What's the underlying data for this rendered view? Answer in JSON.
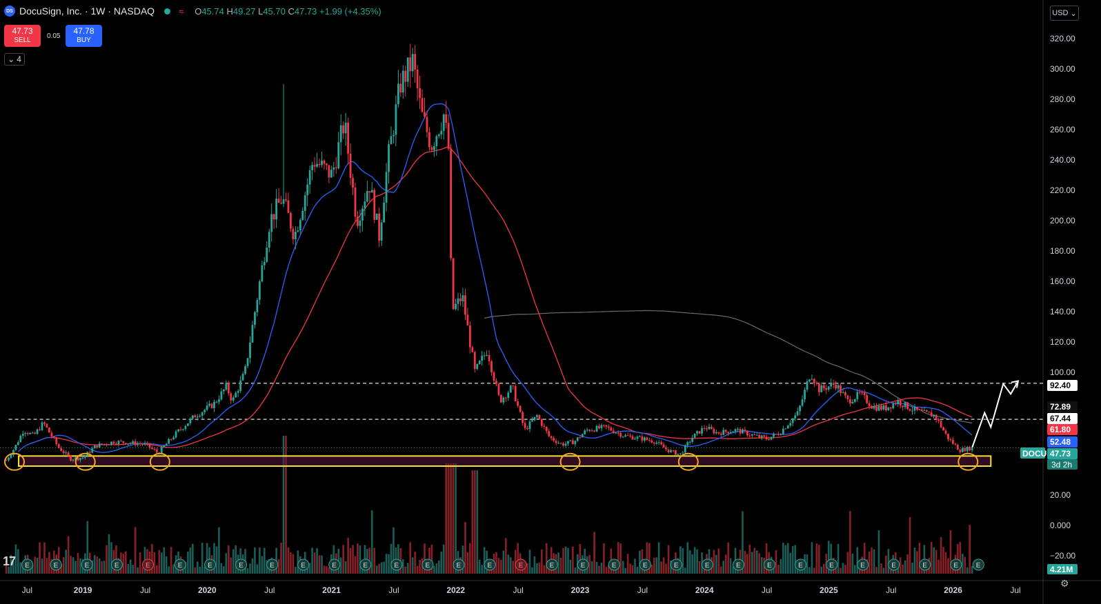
{
  "header": {
    "logo_text": "DS",
    "title": "DocuSign, Inc. · 1W · NASDAQ",
    "wave_icon": "≈",
    "ohlc": {
      "o_label": "O",
      "o": "45.74",
      "h_label": "H",
      "h": "49.27",
      "l_label": "L",
      "l": "45.70",
      "c_label": "C",
      "c": "47.73",
      "change": "+1.99 (+4.35%)"
    }
  },
  "trade": {
    "sell_price": "47.73",
    "sell_label": "SELL",
    "spread": "0.05",
    "buy_price": "47.78",
    "buy_label": "BUY"
  },
  "indicators_count": "4",
  "currency": "USD",
  "tv_logo": "17",
  "colors": {
    "up": "#26a69a",
    "down": "#f23645",
    "ma_fast": "#2962ff",
    "ma_slow": "#f23645",
    "ma_long": "#6b6b6b",
    "zone": "#f5e03a",
    "circle": "#f5a623",
    "bg": "#000000"
  },
  "chart_data": {
    "type": "candlestick",
    "symbol": "DOCU",
    "timeframe": "1W",
    "y_axis_ticks": [
      320,
      300,
      280,
      260,
      240,
      220,
      200,
      180,
      160,
      140,
      120,
      100,
      20,
      0,
      -20
    ],
    "y_axis_tick_labels": [
      "320.00",
      "300.00",
      "280.00",
      "260.00",
      "240.00",
      "220.00",
      "200.00",
      "180.00",
      "160.00",
      "140.00",
      "120.00",
      "100.00",
      "20.00",
      "0.000",
      "−20.00"
    ],
    "ylim": [
      30,
      330
    ],
    "x_axis_labels": [
      {
        "t": 2018.55,
        "label": "Jul"
      },
      {
        "t": 2019.0,
        "label": "2019"
      },
      {
        "t": 2019.5,
        "label": "Jul"
      },
      {
        "t": 2020.0,
        "label": "2020"
      },
      {
        "t": 2020.5,
        "label": "Jul"
      },
      {
        "t": 2021.0,
        "label": "2021"
      },
      {
        "t": 2021.5,
        "label": "Jul"
      },
      {
        "t": 2022.0,
        "label": "2022"
      },
      {
        "t": 2022.5,
        "label": "Jul"
      },
      {
        "t": 2023.0,
        "label": "2023"
      },
      {
        "t": 2023.5,
        "label": "Jul"
      },
      {
        "t": 2024.0,
        "label": "2024"
      },
      {
        "t": 2024.5,
        "label": "Jul"
      },
      {
        "t": 2025.0,
        "label": "2025"
      },
      {
        "t": 2025.5,
        "label": "Jul"
      },
      {
        "t": 2026.0,
        "label": "2026"
      },
      {
        "t": 2026.5,
        "label": "Jul"
      }
    ],
    "xlim": [
      2018.33,
      2026.72
    ],
    "price_path": [
      [
        2018.38,
        39
      ],
      [
        2018.45,
        48
      ],
      [
        2018.52,
        60
      ],
      [
        2018.6,
        56
      ],
      [
        2018.68,
        65
      ],
      [
        2018.8,
        48
      ],
      [
        2018.9,
        40
      ],
      [
        2019.0,
        41
      ],
      [
        2019.1,
        49
      ],
      [
        2019.25,
        52
      ],
      [
        2019.4,
        51
      ],
      [
        2019.5,
        50
      ],
      [
        2019.6,
        44
      ],
      [
        2019.75,
        58
      ],
      [
        2019.9,
        70
      ],
      [
        2020.05,
        78
      ],
      [
        2020.15,
        90
      ],
      [
        2020.2,
        80
      ],
      [
        2020.3,
        100
      ],
      [
        2020.4,
        150
      ],
      [
        2020.5,
        200
      ],
      [
        2020.6,
        215
      ],
      [
        2020.7,
        190
      ],
      [
        2020.85,
        240
      ],
      [
        2021.0,
        230
      ],
      [
        2021.1,
        265
      ],
      [
        2021.2,
        200
      ],
      [
        2021.3,
        225
      ],
      [
        2021.38,
        190
      ],
      [
        2021.45,
        240
      ],
      [
        2021.55,
        290
      ],
      [
        2021.65,
        305
      ],
      [
        2021.72,
        270
      ],
      [
        2021.8,
        250
      ],
      [
        2021.9,
        270
      ],
      [
        2021.95,
        240
      ],
      [
        2021.96,
        140
      ],
      [
        2022.05,
        150
      ],
      [
        2022.15,
        100
      ],
      [
        2022.25,
        115
      ],
      [
        2022.35,
        80
      ],
      [
        2022.45,
        90
      ],
      [
        2022.55,
        60
      ],
      [
        2022.65,
        70
      ],
      [
        2022.75,
        55
      ],
      [
        2022.85,
        50
      ],
      [
        2022.95,
        52
      ],
      [
        2023.05,
        60
      ],
      [
        2023.2,
        62
      ],
      [
        2023.35,
        56
      ],
      [
        2023.5,
        54
      ],
      [
        2023.6,
        52
      ],
      [
        2023.7,
        46
      ],
      [
        2023.8,
        43
      ],
      [
        2023.9,
        55
      ],
      [
        2024.0,
        62
      ],
      [
        2024.1,
        58
      ],
      [
        2024.25,
        60
      ],
      [
        2024.4,
        56
      ],
      [
        2024.5,
        54
      ],
      [
        2024.6,
        58
      ],
      [
        2024.75,
        72
      ],
      [
        2024.85,
        100
      ],
      [
        2024.92,
        88
      ],
      [
        2025.05,
        92
      ],
      [
        2025.15,
        80
      ],
      [
        2025.25,
        85
      ],
      [
        2025.35,
        76
      ],
      [
        2025.45,
        75
      ],
      [
        2025.55,
        80
      ],
      [
        2025.65,
        75
      ],
      [
        2025.75,
        72
      ],
      [
        2025.85,
        70
      ],
      [
        2025.95,
        55
      ],
      [
        2026.05,
        46
      ],
      [
        2026.15,
        47.73
      ]
    ],
    "extremes": {
      "high": 314,
      "high_t": 2021.65,
      "spike_high": 290,
      "spike_t": 2020.62
    },
    "moving_averages": [
      {
        "label": "MA fast",
        "value": "52.48",
        "color": "#2962ff"
      },
      {
        "label": "MA slow",
        "value": "61.80",
        "color": "#f23645"
      },
      {
        "label": "MA long",
        "value": "72.89",
        "color": "#6b6b6b"
      }
    ],
    "price_labels": [
      {
        "text": "92.40",
        "kind": "level"
      },
      {
        "text": "72.89",
        "kind": "ma_long"
      },
      {
        "text": "67.44",
        "kind": "level"
      },
      {
        "text": "61.80",
        "kind": "ma_slow"
      },
      {
        "text": "52.48",
        "kind": "ma_fast"
      },
      {
        "text": "47.73",
        "kind": "last"
      }
    ],
    "last_price": "47.73",
    "countdown": "3d 2h",
    "symbol_tag": "DOCU",
    "volume_label": "4.21M",
    "levels": [
      {
        "price": 92.4,
        "from_t": 2020.1,
        "label": "92.40"
      },
      {
        "price": 67.44,
        "from_t": 2018.4,
        "label": "67.44"
      }
    ],
    "support_zone": {
      "from": 35,
      "to": 42,
      "t_start": 2018.38,
      "t_end": 2026.3
    },
    "circled_lows": [
      2018.38,
      2018.95,
      2019.55,
      2022.85,
      2023.8,
      2026.05
    ],
    "projection": [
      [
        2026.15,
        48
      ],
      [
        2026.25,
        72
      ],
      [
        2026.3,
        62
      ],
      [
        2026.4,
        92
      ],
      [
        2026.46,
        85
      ],
      [
        2026.52,
        94
      ]
    ],
    "earnings_marker": "E",
    "earnings_t": [
      2018.55,
      2018.78,
      2019.03,
      2019.27,
      2019.52,
      2019.78,
      2020.02,
      2020.27,
      2020.52,
      2020.77,
      2021.02,
      2021.27,
      2021.52,
      2021.77,
      2022.02,
      2022.27,
      2022.52,
      2022.77,
      2023.02,
      2023.27,
      2023.52,
      2023.77,
      2024.02,
      2024.27,
      2024.52,
      2024.77,
      2025.02,
      2025.27,
      2025.52,
      2025.77,
      2026.02,
      2026.2
    ],
    "earnings_miss_t": [
      2019.52,
      2022.52
    ]
  }
}
